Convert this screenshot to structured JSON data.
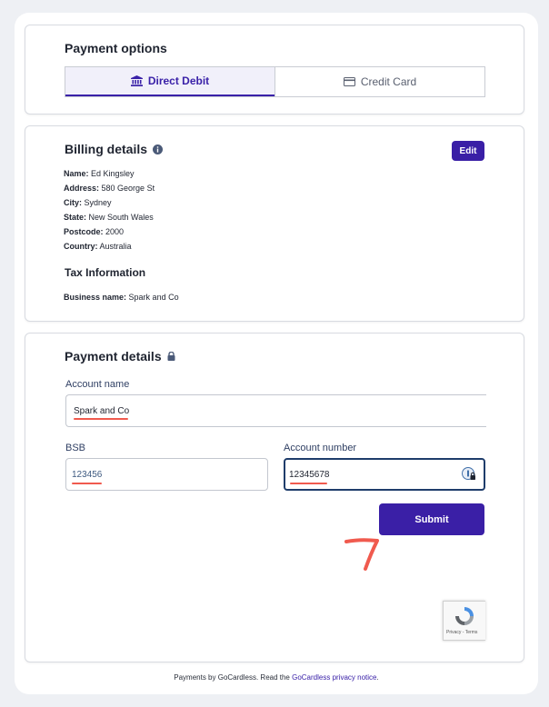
{
  "payment_options": {
    "title": "Payment options",
    "tabs": [
      {
        "label": "Direct Debit",
        "active": true
      },
      {
        "label": "Credit Card",
        "active": false
      }
    ]
  },
  "billing": {
    "title": "Billing details",
    "edit_label": "Edit",
    "fields": [
      {
        "key": "Name:",
        "value": "Ed Kingsley"
      },
      {
        "key": "Address:",
        "value": "580 George St"
      },
      {
        "key": "City:",
        "value": "Sydney"
      },
      {
        "key": "State:",
        "value": "New South Wales"
      },
      {
        "key": "Postcode:",
        "value": "2000"
      },
      {
        "key": "Country:",
        "value": "Australia"
      }
    ],
    "tax_title": "Tax Information",
    "business": {
      "key": "Business name:",
      "value": "Spark and Co"
    }
  },
  "payment": {
    "title": "Payment details",
    "account_name_label": "Account name",
    "account_name_value": "Spark and Co",
    "bsb_label": "BSB",
    "bsb_value": "123456",
    "account_number_label": "Account number",
    "account_number_value": "12345678",
    "submit_label": "Submit"
  },
  "recaptcha": {
    "terms": "Privacy - Terms"
  },
  "footer": {
    "prefix": "Payments by GoCardless. Read the ",
    "link": "GoCardless privacy notice",
    "suffix": "."
  },
  "colors": {
    "accent": "#3a1fa6",
    "annotation": "#f05a4e"
  }
}
